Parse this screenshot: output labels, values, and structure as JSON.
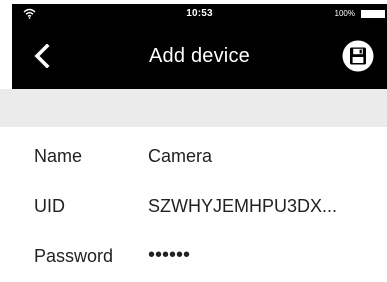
{
  "status_bar": {
    "time": "10:53",
    "battery_percent": "100%"
  },
  "navbar": {
    "title": "Add device",
    "back_icon": "chevron-left-icon",
    "save_icon": "floppy-disk-icon"
  },
  "form": {
    "name_label": "Name",
    "name_value": "Camera",
    "uid_label": "UID",
    "uid_value": "SZWHYJEMHPU3DX...",
    "password_label": "Password",
    "password_value": "••••••"
  },
  "colors": {
    "header": "#000000",
    "band": "#ebebeb",
    "text": "#222222"
  }
}
